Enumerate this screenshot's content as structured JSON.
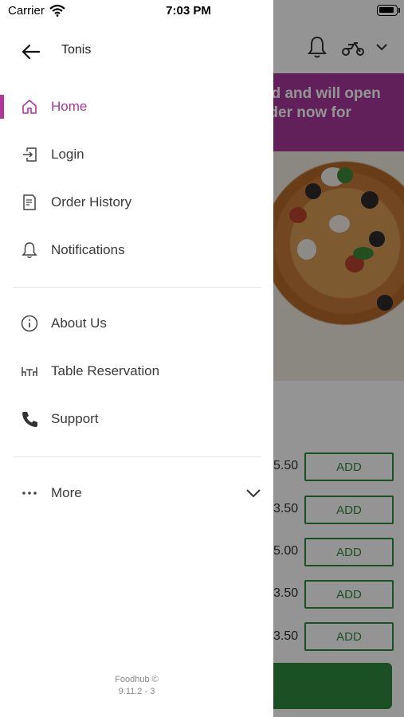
{
  "status_bar": {
    "carrier": "Carrier",
    "time": "7:03 PM"
  },
  "drawer": {
    "user_name": "Tonis",
    "menu_primary": [
      {
        "label": "Home",
        "icon": "home-icon",
        "active": true
      },
      {
        "label": "Login",
        "icon": "login-icon"
      },
      {
        "label": "Order History",
        "icon": "receipt-icon"
      },
      {
        "label": "Notifications",
        "icon": "bell-icon"
      }
    ],
    "menu_secondary": [
      {
        "label": "About Us",
        "icon": "info-icon"
      },
      {
        "label": "Table Reservation",
        "icon": "table-icon"
      },
      {
        "label": "Support",
        "icon": "phone-icon"
      }
    ],
    "more_label": "More",
    "footer": {
      "brand": "Foodhub ©",
      "version": "9.11.2 - 3"
    }
  },
  "background": {
    "banner_line1": "ed and will open",
    "banner_line2": "rder now for",
    "rows": [
      {
        "price": "5.50",
        "add": "ADD"
      },
      {
        "price": "3.50",
        "add": "ADD"
      },
      {
        "price": "5.00",
        "add": "ADD"
      },
      {
        "price": "3.50",
        "add": "ADD"
      },
      {
        "price": "3.50",
        "add": "ADD"
      }
    ]
  },
  "colors": {
    "accent": "#b0359d",
    "banner": "#a8389c",
    "add_green": "#2e8b3d"
  }
}
